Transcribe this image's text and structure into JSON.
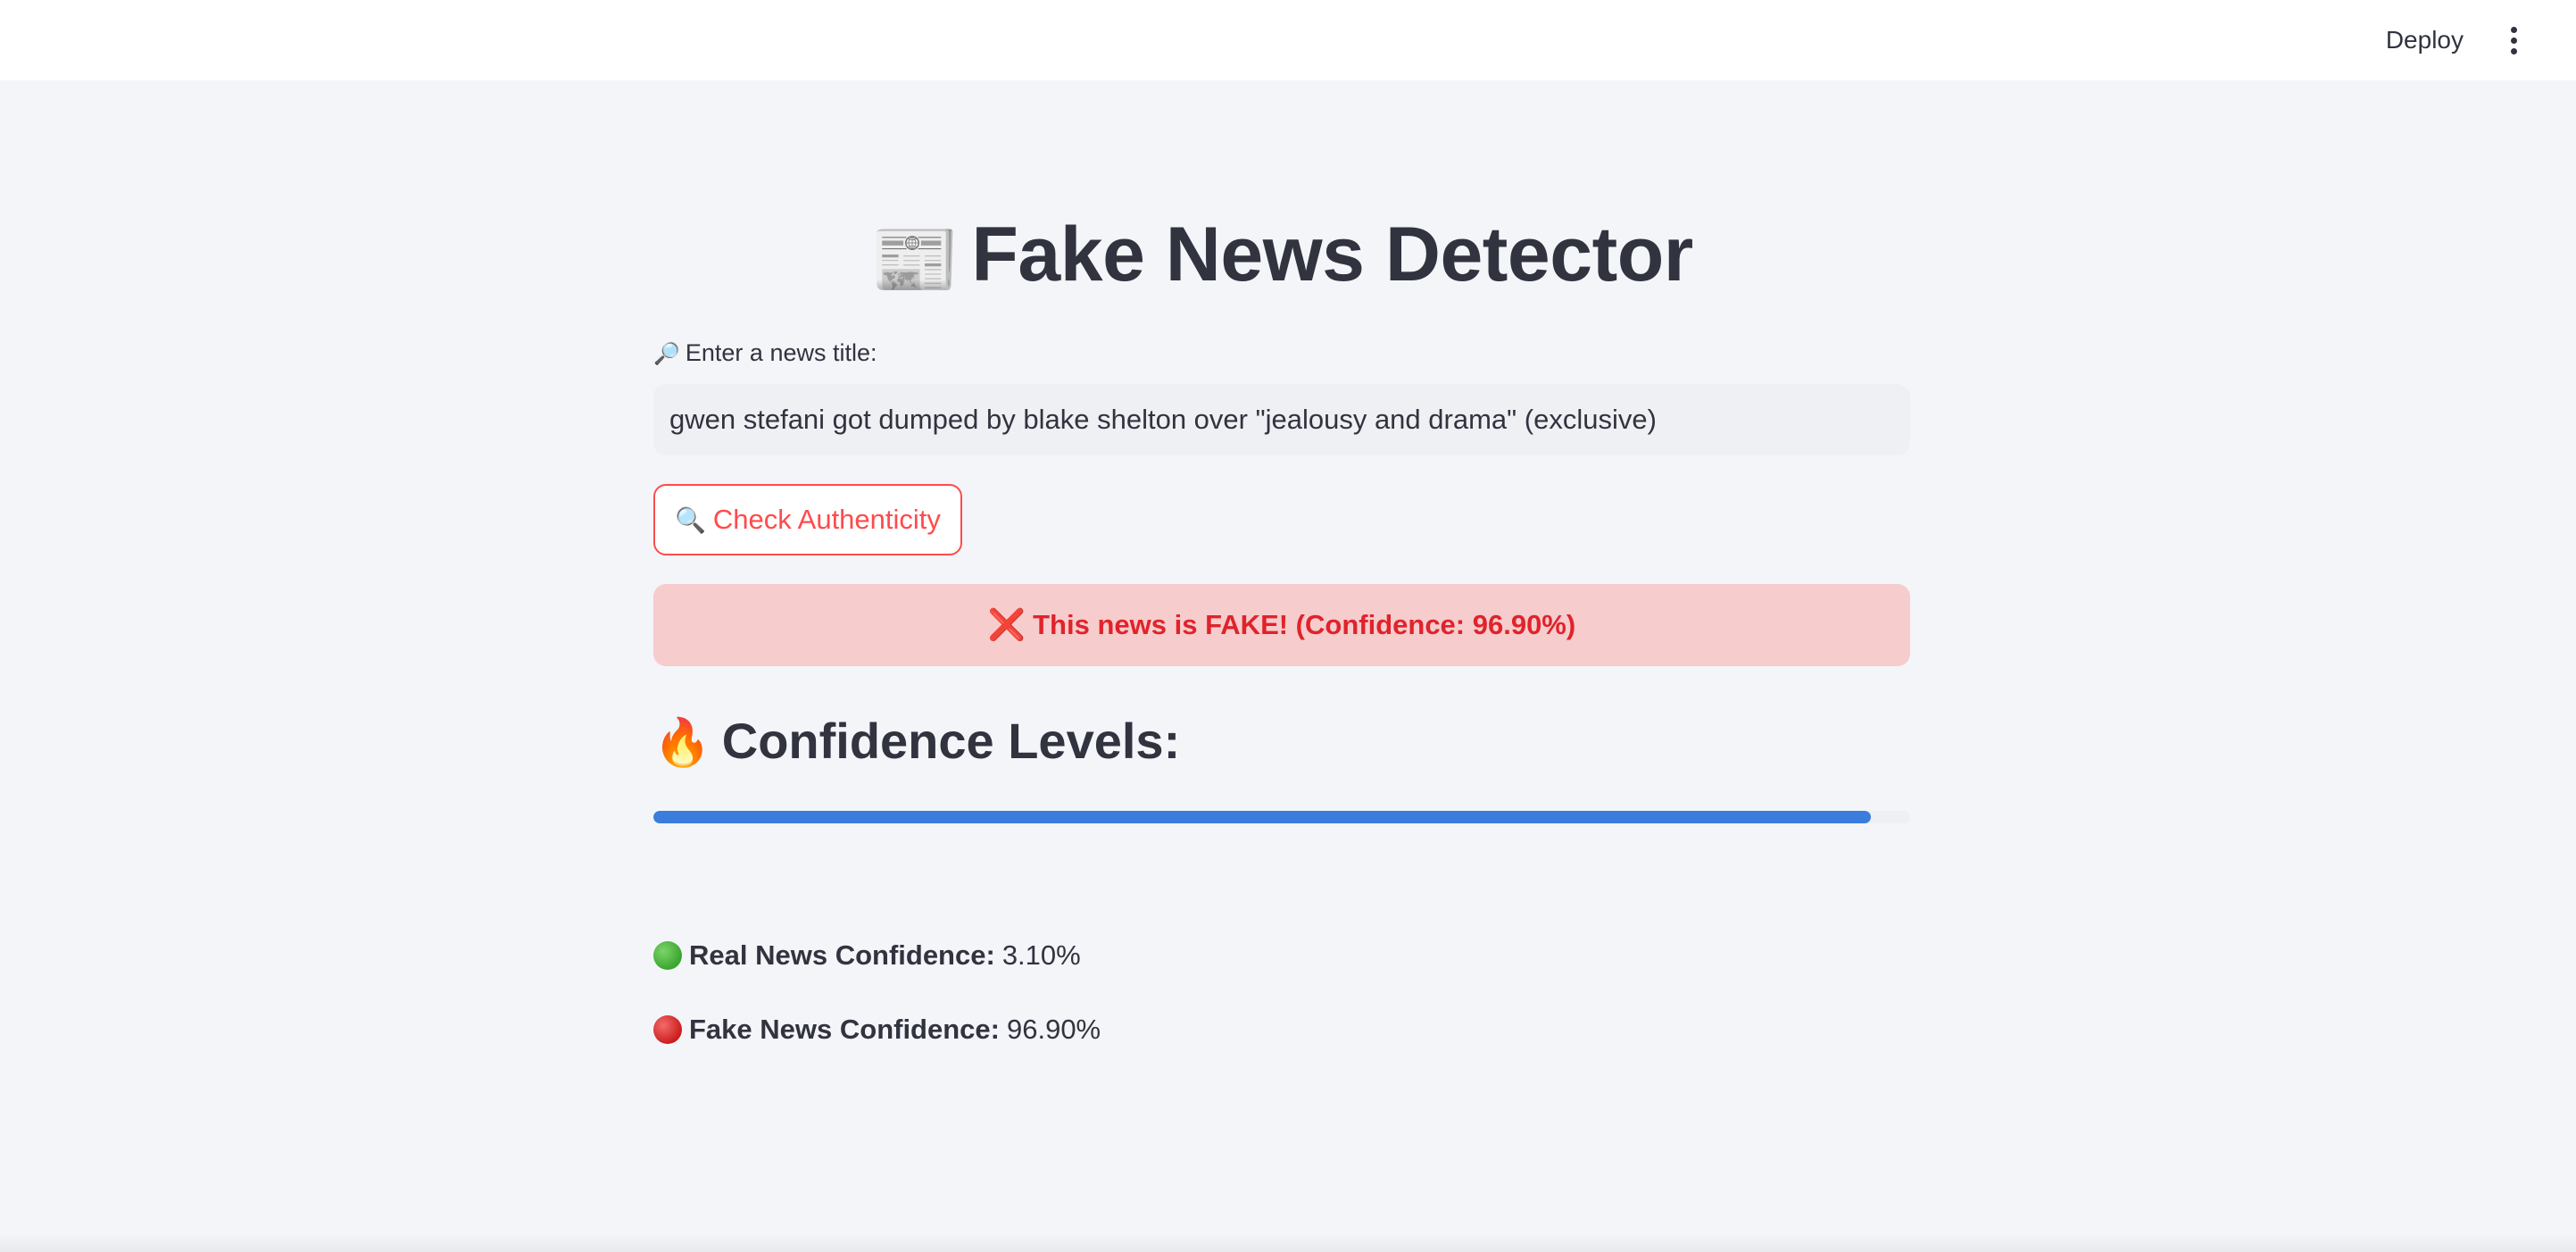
{
  "header": {
    "deploy_label": "Deploy",
    "menu_icon": "more-vertical-icon"
  },
  "main": {
    "title_emoji": "📰",
    "title": "Fake News Detector",
    "input_label_emoji": "🔎",
    "input_label": "Enter a news title:",
    "input_value": "gwen stefani got dumped by blake shelton over \"jealousy and drama\" (exclusive)",
    "check_button_emoji": "🔍",
    "check_button_label": "Check Authenticity",
    "result_icon": "❌",
    "result_text": "This news is FAKE! (Confidence: 96.90%)",
    "confidence_heading_emoji": "🔥",
    "confidence_heading": "Confidence Levels:",
    "progress_value": 0.969,
    "real_label": "Real News Confidence:",
    "real_value": "3.10%",
    "fake_label": "Fake News Confidence:",
    "fake_value": "96.90%"
  },
  "colors": {
    "accent": "#ff4b4b",
    "progress": "#3b7ddd",
    "result_bg": "#f6cccd",
    "result_text": "#e0232b"
  }
}
